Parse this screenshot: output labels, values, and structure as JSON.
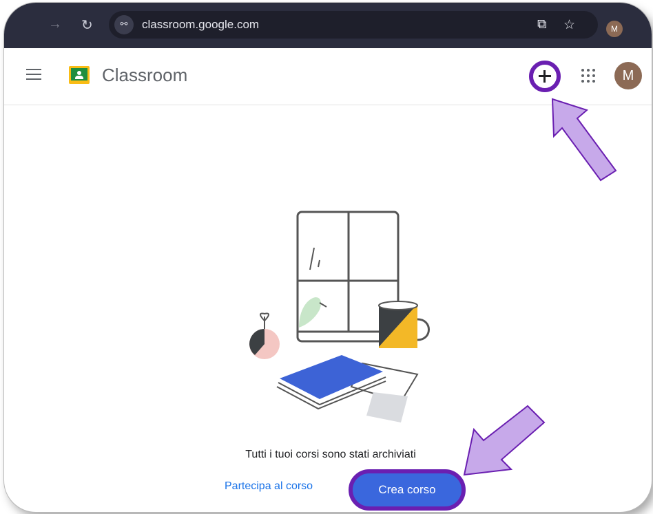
{
  "browser": {
    "url": "classroom.google.com",
    "site_icon": "⚲",
    "avatar_initial": "M"
  },
  "app": {
    "title": "Classroom",
    "avatar_initial": "M"
  },
  "main": {
    "empty_message": "Tutti i tuoi corsi sono stati archiviati",
    "join_label": "Partecipa al corso",
    "create_label": "Crea corso"
  },
  "colors": {
    "annotation": "#6a1fb1",
    "arrow_fill": "#c7a9ea",
    "primary": "#3a67dd",
    "link": "#1a73e8"
  }
}
